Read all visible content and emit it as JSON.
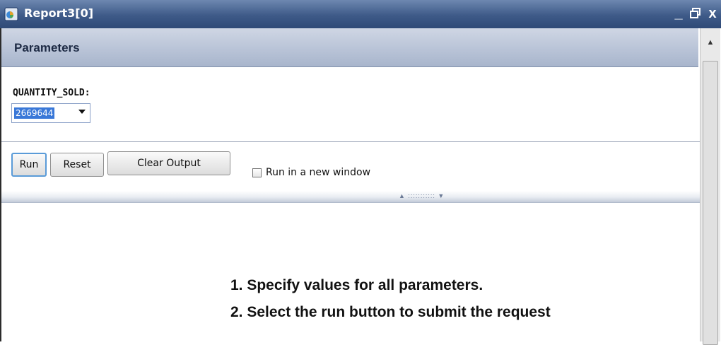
{
  "window": {
    "title": "Report3[0]",
    "controls": {
      "minimize": "_",
      "restore": "⧉",
      "close": "x"
    }
  },
  "panel": {
    "title": "Parameters"
  },
  "parameter": {
    "label": "QUANTITY_SOLD:",
    "selected_value": "2669644"
  },
  "buttons": {
    "run": "Run",
    "reset": "Reset",
    "clear_output": "Clear Output"
  },
  "options": {
    "run_new_window_label": "Run in a new window",
    "run_new_window_checked": false
  },
  "instructions": [
    "1. Specify values for all parameters.",
    "2. Select the run button to submit the request"
  ],
  "colors": {
    "titlebar": "#3e5a88",
    "panel_header": "#b7c2d6",
    "selection": "#3a78d8",
    "run_focus": "#5a9bd8"
  }
}
